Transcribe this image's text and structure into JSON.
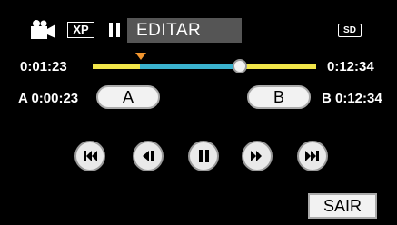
{
  "header": {
    "mode_icon": "video-camera-icon",
    "quality_badge": "XP",
    "state_icon": "pause-icon",
    "title": "EDITAR",
    "media_badge": "SD"
  },
  "timeline": {
    "current_time": "0:01:23",
    "end_time": "0:12:34",
    "marker_position": 0.17,
    "playhead_position": 0.67
  },
  "points": {
    "a_label": "A",
    "a_time": "A 0:00:23",
    "b_label": "B",
    "b_time": "B 0:12:34"
  },
  "controls": [
    {
      "name": "skip-back-button",
      "icon": "skip-back-icon"
    },
    {
      "name": "frame-back-button",
      "icon": "frame-back-icon"
    },
    {
      "name": "pause-button",
      "icon": "pause-icon"
    },
    {
      "name": "fast-forward-button",
      "icon": "fast-forward-icon"
    },
    {
      "name": "skip-forward-button",
      "icon": "skip-forward-icon"
    }
  ],
  "footer": {
    "exit_label": "SAIR"
  },
  "colors": {
    "background": "#000000",
    "track_yellow": "#f2e64a",
    "track_blue": "#3bb3cf",
    "marker_orange": "#f2962f",
    "title_bar": "#555555"
  }
}
